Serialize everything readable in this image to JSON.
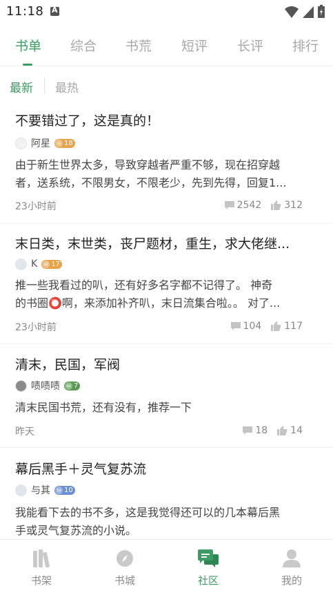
{
  "status_bar": {
    "time": "11:18",
    "notification_icon": "a-icon",
    "icons": [
      "wifi-icon",
      "signal-icon",
      "battery-icon"
    ]
  },
  "tabs": [
    {
      "label": "书单",
      "active": true
    },
    {
      "label": "综合",
      "active": false
    },
    {
      "label": "书荒",
      "active": false
    },
    {
      "label": "短评",
      "active": false
    },
    {
      "label": "长评",
      "active": false
    },
    {
      "label": "排行",
      "active": false
    }
  ],
  "sort": {
    "newest": "最新",
    "hottest": "最热",
    "selected": "最新"
  },
  "posts": [
    {
      "title": "不要错过了，这是真的！",
      "author": "阿星",
      "level": "18",
      "level_color": "#e8a24a",
      "body_lines": [
        "由于新生世界太多，导致穿越者严重不够，现在招穿越",
        "者，送系统，不限男女，不限老少，先到先得，回复1..."
      ],
      "time": "23小时前",
      "comments": "2542",
      "likes": "312"
    },
    {
      "title": "末日类，末世类，丧尸题材，重生，求大佬继...",
      "author": "K",
      "level": "17",
      "level_color": "#e8a24a",
      "body_lines": [
        "推一些我看过的叭，还有好多名字都不记得了。 神奇",
        "的书圈⭕啊，来添加补齐叭，末日流集合啦。。 对了..."
      ],
      "time": "23小时前",
      "comments": "104",
      "likes": "117"
    },
    {
      "title": "清末，民国，军阀",
      "author": "啧啧啧",
      "level": "7",
      "level_color": "#5a9a52",
      "body_lines": [
        "清末民国书荒，还有没有，推荐一下"
      ],
      "time": "昨天",
      "comments": "18",
      "likes": "14"
    },
    {
      "title": "幕后黑手＋灵气复苏流",
      "author": "与其",
      "level": "10",
      "level_color": "#6b8fd4",
      "body_lines": [
        "我能看下去的书不多，这是我觉得还可以的几本幕后黑",
        "手或灵气复苏流的小说。"
      ],
      "time": "",
      "comments": "",
      "likes": ""
    }
  ],
  "bottom_nav": [
    {
      "label": "书架",
      "icon": "bookshelf-icon",
      "active": false
    },
    {
      "label": "书城",
      "icon": "compass-icon",
      "active": false
    },
    {
      "label": "社区",
      "icon": "chat-icon",
      "active": true
    },
    {
      "label": "我的",
      "icon": "person-icon",
      "active": false
    }
  ],
  "colors": {
    "accent": "#3d9b63",
    "inactive": "#a8a8a8"
  }
}
